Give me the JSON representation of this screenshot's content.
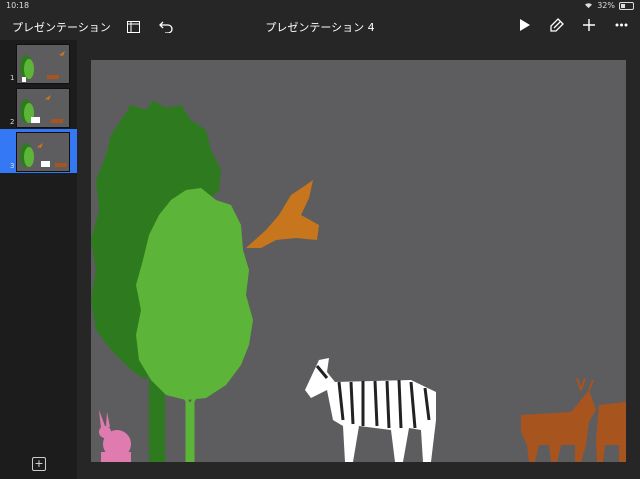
{
  "status": {
    "time": "10:18",
    "battery_text": "32%",
    "battery_level": 0.32
  },
  "toolbar": {
    "presentations_label": "プレゼンテーション",
    "title": "プレゼンテーション 4"
  },
  "slides": [
    {
      "number": "1"
    },
    {
      "number": "2"
    },
    {
      "number": "3"
    }
  ],
  "selected_slide": 3,
  "colors": {
    "accent": "#3478f6",
    "slide_bg": "#5d5d5f",
    "tree_dark": "#2e7a1e",
    "tree_light": "#5cb538",
    "bird": "#c8761e",
    "deer": "#a8541e",
    "rabbit": "#e07bb0",
    "zebra": "#ffffff"
  },
  "icons": [
    "wifi-icon",
    "battery-icon",
    "slides-view-icon",
    "undo-icon",
    "play-icon",
    "format-brush-icon",
    "plus-icon",
    "more-icon",
    "add-slide-icon"
  ]
}
